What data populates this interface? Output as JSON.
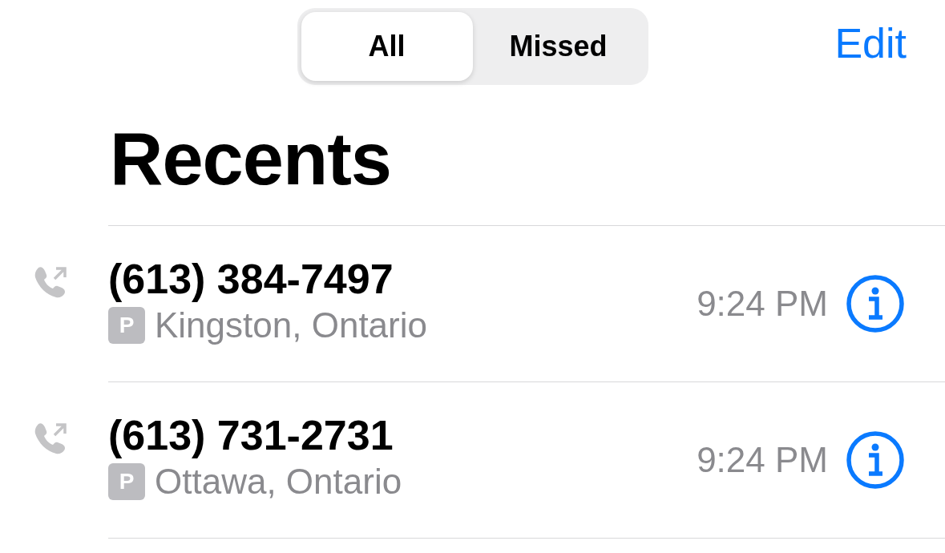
{
  "segments": [
    {
      "label": "All",
      "selected": true
    },
    {
      "label": "Missed",
      "selected": false
    }
  ],
  "edit": "Edit",
  "title": "Recents",
  "calls": [
    {
      "number": "(613) 384-7497",
      "badge": "P",
      "location": "Kingston, Ontario",
      "time": "9:24 PM"
    },
    {
      "number": "(613) 731-2731",
      "badge": "P",
      "location": "Ottawa, Ontario",
      "time": "9:24 PM"
    }
  ]
}
